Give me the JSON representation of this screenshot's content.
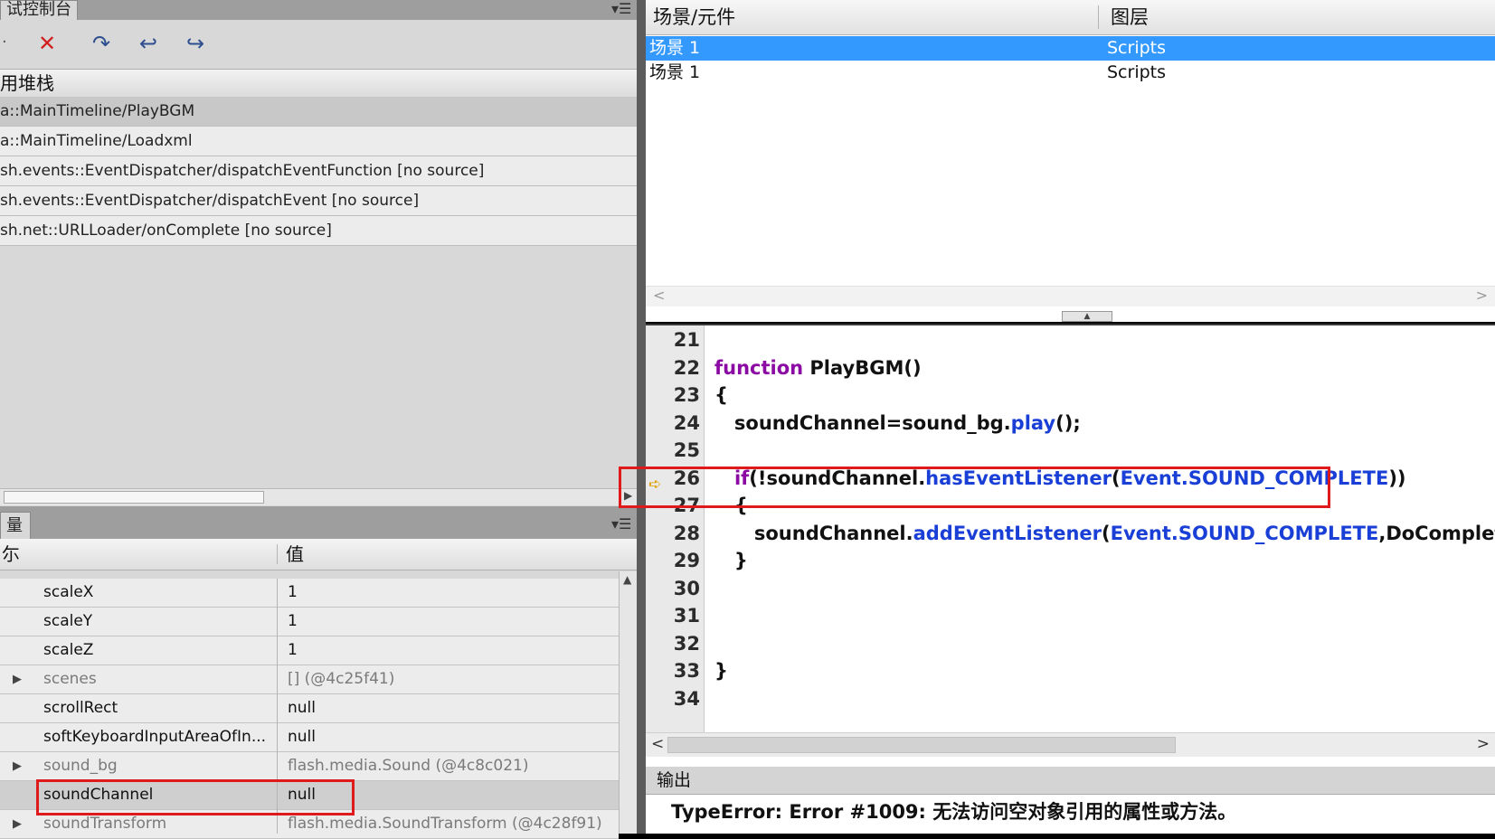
{
  "left_panel": {
    "title_tab": "试控制台",
    "toolbar": {
      "stop_label": "✕",
      "step_over_label": "↷",
      "step_in_label": "↩",
      "step_out_label": "↪"
    },
    "stack_header": "用堆栈",
    "stack_items": [
      "a::MainTimeline/PlayBGM",
      "a::MainTimeline/Loadxml",
      "sh.events::EventDispatcher/dispatchEventFunction [no source]",
      "sh.events::EventDispatcher/dispatchEvent [no source]",
      "sh.net::URLLoader/onComplete [no source]"
    ]
  },
  "variables_panel": {
    "title_tab": "量",
    "col_name": "尓",
    "col_value": "值",
    "rows": [
      {
        "name": "scaleX",
        "value": "1",
        "expand": "",
        "dim": false
      },
      {
        "name": "scaleY",
        "value": "1",
        "expand": "",
        "dim": false
      },
      {
        "name": "scaleZ",
        "value": "1",
        "expand": "",
        "dim": false
      },
      {
        "name": "scenes",
        "value": "[] (@4c25f41)",
        "expand": "▶",
        "dim": true
      },
      {
        "name": "scrollRect",
        "value": "null",
        "expand": "",
        "dim": false
      },
      {
        "name": "softKeyboardInputAreaOfIn...",
        "value": "null",
        "expand": "",
        "dim": false
      },
      {
        "name": "sound_bg",
        "value": "flash.media.Sound (@4c8c021)",
        "expand": "▶",
        "dim": true
      },
      {
        "name": "soundChannel",
        "value": "null",
        "expand": "",
        "dim": false
      },
      {
        "name": "soundTransform",
        "value": "flash.media.SoundTransform (@4c28f91)",
        "expand": "▶",
        "dim": true
      }
    ]
  },
  "scene_panel": {
    "col_scene": "场景/元件",
    "col_layer": "图层",
    "rows": [
      {
        "scene": "场景 1",
        "layer": "Scripts"
      },
      {
        "scene": "场景 1",
        "layer": "Scripts"
      }
    ]
  },
  "code_panel": {
    "lines": [
      {
        "no": "21",
        "parts": []
      },
      {
        "no": "22",
        "parts": [
          {
            "t": "function",
            "c": "kw"
          },
          {
            "t": " PlayBGM()",
            "c": ""
          }
        ]
      },
      {
        "no": "23",
        "parts": [
          {
            "t": "{",
            "c": ""
          }
        ]
      },
      {
        "no": "24",
        "parts": [
          {
            "t": "   soundChannel=sound_bg.",
            "c": ""
          },
          {
            "t": "play",
            "c": "fn"
          },
          {
            "t": "();",
            "c": ""
          }
        ]
      },
      {
        "no": "25",
        "parts": []
      },
      {
        "no": "26",
        "parts": [
          {
            "t": "   ",
            "c": ""
          },
          {
            "t": "if",
            "c": "kw"
          },
          {
            "t": "(!soundChannel.",
            "c": ""
          },
          {
            "t": "hasEventListener",
            "c": "fn"
          },
          {
            "t": "(",
            "c": ""
          },
          {
            "t": "Event.SOUND_COMPLETE",
            "c": "ev"
          },
          {
            "t": "))",
            "c": ""
          }
        ]
      },
      {
        "no": "27",
        "parts": [
          {
            "t": "   {",
            "c": ""
          }
        ]
      },
      {
        "no": "28",
        "parts": [
          {
            "t": "      soundChannel.",
            "c": ""
          },
          {
            "t": "addEventListener",
            "c": "fn"
          },
          {
            "t": "(",
            "c": ""
          },
          {
            "t": "Event.SOUND_COMPLETE",
            "c": "ev"
          },
          {
            "t": ",DoComplete);",
            "c": ""
          }
        ]
      },
      {
        "no": "29",
        "parts": [
          {
            "t": "   }",
            "c": ""
          }
        ]
      },
      {
        "no": "30",
        "parts": []
      },
      {
        "no": "31",
        "parts": []
      },
      {
        "no": "32",
        "parts": []
      },
      {
        "no": "33",
        "parts": [
          {
            "t": "}",
            "c": ""
          }
        ]
      },
      {
        "no": "34",
        "parts": []
      }
    ],
    "breakpoint_marker": "➪"
  },
  "output_panel": {
    "tab_label": "输出",
    "error_text": "TypeError: Error #1009: 无法访问空对象引用的属性或方法。"
  },
  "colors": {
    "highlight_box": "#e0191b",
    "selection": "#3399ff",
    "keyword": "#8b0aa3",
    "method": "#1a3fd6"
  }
}
